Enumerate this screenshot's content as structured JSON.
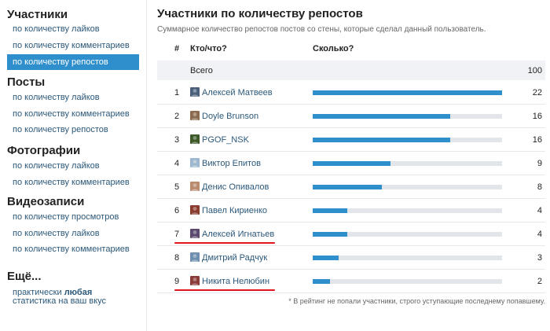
{
  "sidebar": {
    "sections": [
      {
        "title": "Участники",
        "links": [
          "по количеству лайков",
          "по количеству комментариев",
          "по количеству репостов"
        ],
        "active": 2
      },
      {
        "title": "Посты",
        "links": [
          "по количеству лайков",
          "по количеству комментариев",
          "по количеству репостов"
        ]
      },
      {
        "title": "Фотографии",
        "links": [
          "по количеству лайков",
          "по количеству комментариев"
        ]
      },
      {
        "title": "Видеозаписи",
        "links": [
          "по количеству просмотров",
          "по количеству лайков",
          "по количеству комментариев"
        ]
      }
    ],
    "more": {
      "title": "Ещё...",
      "line1_prefix": "практически ",
      "line1_bold": "любая",
      "line2": "статистика на ваш вкус"
    }
  },
  "main": {
    "title": "Участники по количеству репостов",
    "subtitle": "Суммарное количество репостов постов со стены, которые сделал данный пользователь.",
    "headers": {
      "rank": "#",
      "who": "Кто/что?",
      "how_many": "Сколько?"
    },
    "total": {
      "label": "Всего",
      "value": "100"
    },
    "rows": [
      {
        "rank": "1",
        "name": "Алексей Матвеев",
        "count": "22",
        "avatar_color": "#4b5f7c"
      },
      {
        "rank": "2",
        "name": "Doyle Brunson",
        "count": "16",
        "avatar_color": "#8c6a4f"
      },
      {
        "rank": "3",
        "name": "PGOF_NSK",
        "count": "16",
        "avatar_color": "#3e5a2b"
      },
      {
        "rank": "4",
        "name": "Виктор Епитов",
        "count": "9",
        "avatar_color": "#9db7cf"
      },
      {
        "rank": "5",
        "name": "Денис Опивалов",
        "count": "8",
        "avatar_color": "#b88a6e"
      },
      {
        "rank": "6",
        "name": "Павел Кириенко",
        "count": "4",
        "avatar_color": "#8a3c2e"
      },
      {
        "rank": "7",
        "name": "Алексей Игнатьев",
        "count": "4",
        "avatar_color": "#5b4a6e",
        "underlined": true
      },
      {
        "rank": "8",
        "name": "Дмитрий Радчук",
        "count": "3",
        "avatar_color": "#6f8fb0"
      },
      {
        "rank": "9",
        "name": "Никита Нелюбин",
        "count": "2",
        "avatar_color": "#8b3a3a",
        "underlined": true
      }
    ],
    "bar_max": 22,
    "footnote": "* В рейтинг не попали участники, строго уступающие последнему попавшему."
  },
  "colors": {
    "accent": "#2f8fcd",
    "link": "#2b587a",
    "underline": "#e0151d"
  }
}
